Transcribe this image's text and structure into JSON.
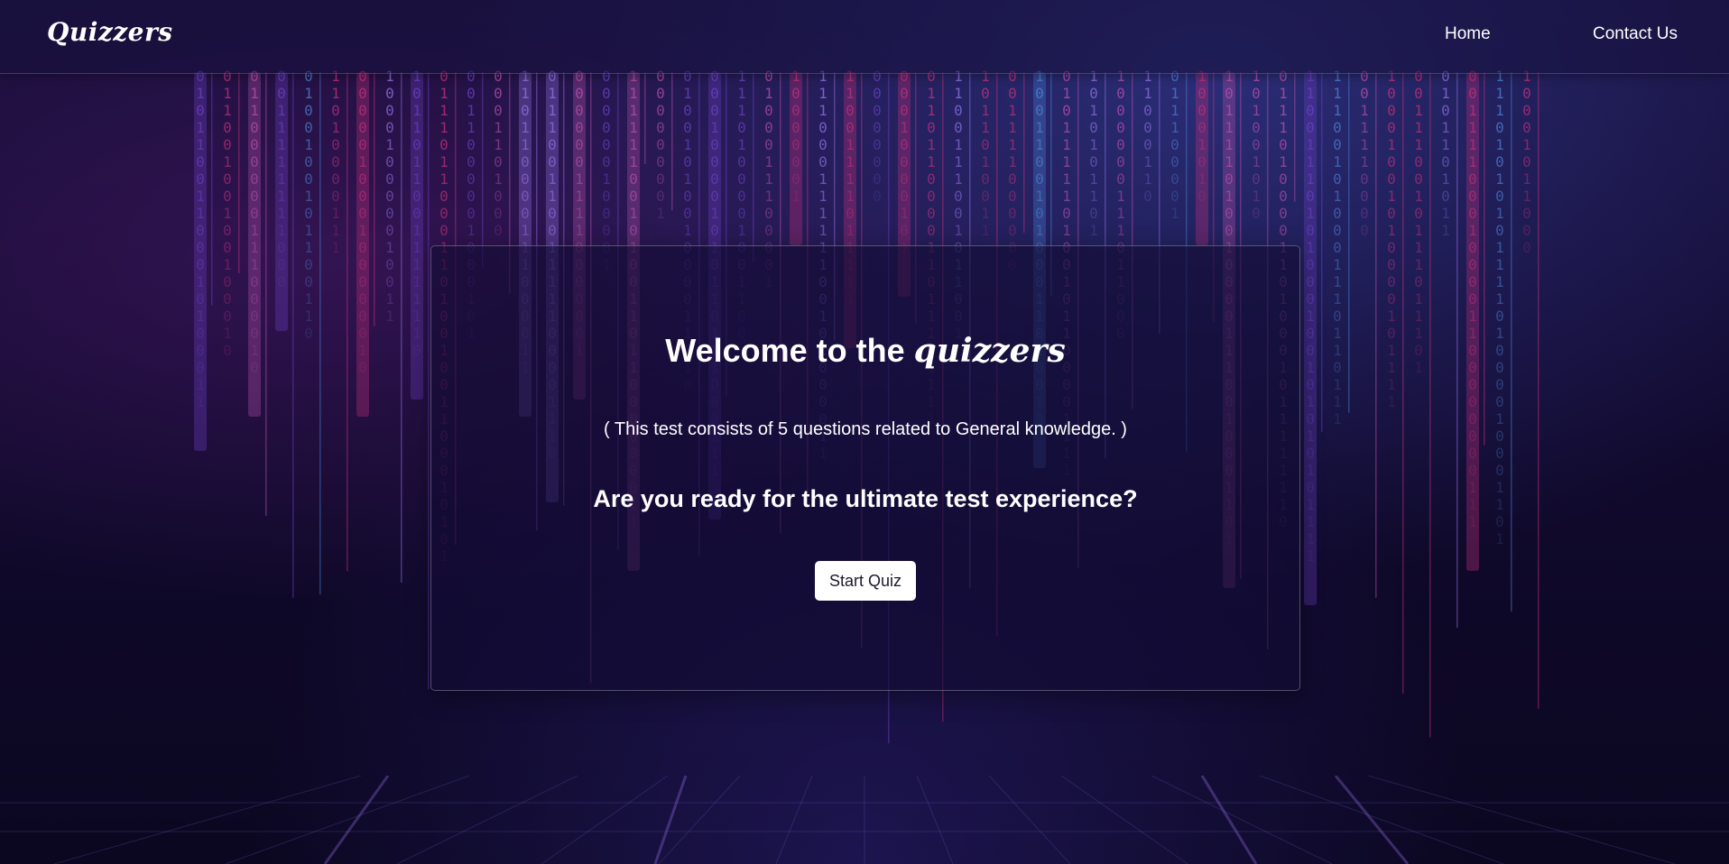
{
  "header": {
    "brand": "Quizzers",
    "nav": [
      {
        "label": "Home"
      },
      {
        "label": "Contact Us"
      }
    ]
  },
  "main": {
    "welcome_prefix": "Welcome to the",
    "welcome_brand": "quizzers",
    "subtitle": "( This test consists of 5 questions related to General knowledge. )",
    "question": "Are you ready for the ultimate test experience?",
    "start_button": "Start Quiz"
  },
  "theme": {
    "background": "#120a30",
    "pink": "#c0307a",
    "blue": "#4a7fd0",
    "violet": "#6a3fc0"
  },
  "background_image": "binary-code-rain"
}
